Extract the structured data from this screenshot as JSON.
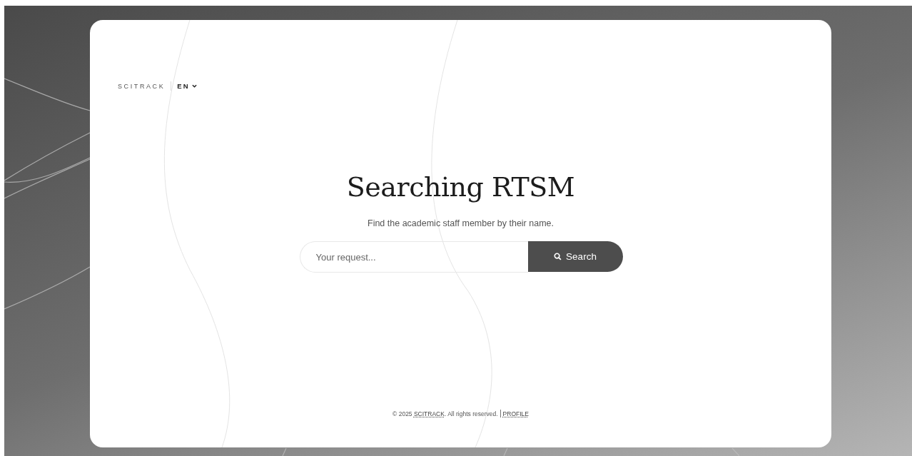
{
  "header": {
    "brand": "SCITRACK",
    "language": "EN"
  },
  "hero": {
    "title": "Searching RTSM",
    "subtitle": "Find the academic staff member by their name."
  },
  "search": {
    "placeholder": "Your request...",
    "button": "Search"
  },
  "footer": {
    "copyright": "© 2025 ",
    "brand_link": "SCITRACK",
    "rights": ". All rights reserved.",
    "profile_link": "PROFILE"
  }
}
